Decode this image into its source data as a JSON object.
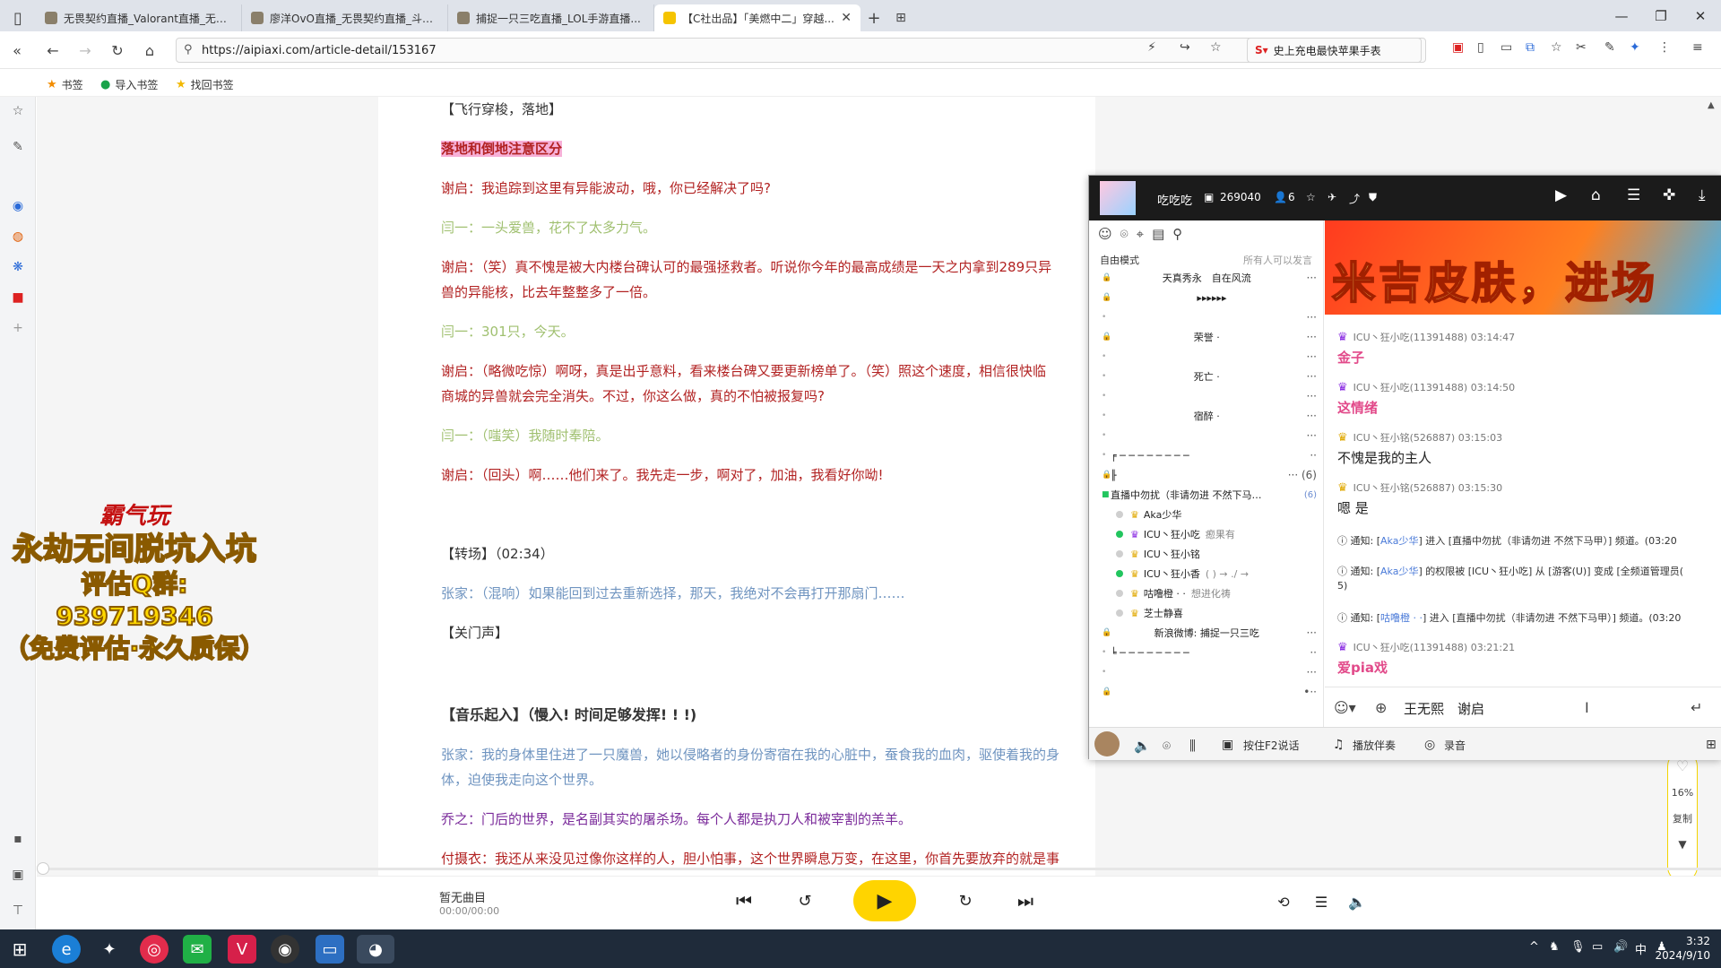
{
  "browser": {
    "tabs": [
      {
        "title": "无畏契约直播_Valorant直播_无畏..."
      },
      {
        "title": "廖洋OvO直播_无畏契约直播_斗鱼..."
      },
      {
        "title": "捕捉一只三吃直播_LOL手游直播..."
      },
      {
        "title": "【C社出品】「美燃中二」穿越..."
      }
    ],
    "url": "https://aipiaxi.com/article-detail/153167",
    "search_text": "史上充电最快苹果手表",
    "bookmarks": [
      "书签",
      "导入书签",
      "找回书签"
    ]
  },
  "article": {
    "lines": [
      {
        "text": "【飞行穿梭，落地】",
        "style": "dk"
      },
      {
        "text": "落地和倒地注意区分",
        "style": "hl"
      },
      {
        "text": "谢启：我追踪到这里有异能波动，哦，你已经解决了吗?",
        "style": "red"
      },
      {
        "text": "闫一：一头爱兽，花不了太多力气。",
        "style": "lg"
      },
      {
        "text": "谢启：（笑）真不愧是被大内楼台碑认可的最强拯救者。听说你今年的最高成绩是一天之内拿到289只异",
        "style": "red"
      },
      {
        "text": "兽的异能核，比去年整整多了一倍。",
        "style": "red"
      },
      {
        "text": "闫一：301只，今天。",
        "style": "lg"
      },
      {
        "text": "谢启：（略微吃惊）啊呀，真是出乎意料，看来楼台碑又要更新榜单了。（笑）照这个速度，相信很快临",
        "style": "red"
      },
      {
        "text": "商城的异兽就会完全消失。不过，你这么做，真的不怕被报复吗?",
        "style": "red"
      },
      {
        "text": "闫一：（嗤笑）我随时奉陪。",
        "style": "lg"
      },
      {
        "text": "谢启：（回头）啊……他们来了。我先走一步，啊对了，加油，我看好你呦!",
        "style": "red"
      },
      {
        "text": "【转场】（02:34）",
        "style": "dk"
      },
      {
        "text": "张家：（混响）如果能回到过去重新选择，那天，我绝对不会再打开那扇门……",
        "style": "bl"
      },
      {
        "text": "【关门声】",
        "style": "dk"
      },
      {
        "text": "【音乐起入】（慢入! 时间足够发挥! ! !)",
        "style": "bold"
      },
      {
        "text": "张家：我的身体里住进了一只魔兽，她以侵略者的身份寄宿在我的心脏中，蚕食我的血肉，驱使着我的身",
        "style": "bl"
      },
      {
        "text": "体，迫使我走向这个世界。",
        "style": "bl"
      },
      {
        "text": "乔之：门后的世界，是名副其实的屠杀场。每个人都是执刀人和被宰割的羔羊。",
        "style": "pu"
      },
      {
        "text": "付摄衣：我还从来没见过像你这样的人，胆小怕事，这个世界瞬息万变，在这里，你首先要放弃的就是事",
        "style": "red"
      }
    ]
  },
  "promo": {
    "line1": "霸气玩",
    "line2": "永劫无间脱坑入坑",
    "line3": "评估Q群: 939719346",
    "line4": "（免费评估·永久质保）"
  },
  "widget": {
    "percent": "16%",
    "copy": "复制"
  },
  "player": {
    "track": "暂无曲目",
    "time": "00:00/00:00",
    "progress": 0
  },
  "taskbar": {
    "time": "3:32",
    "date": "2024/9/10",
    "ime": "中"
  },
  "yy": {
    "header": {
      "name": "吃吃吃",
      "id": "269040",
      "count": "6"
    },
    "mode": "自由模式",
    "mode_hint": "所有人可以发言",
    "channels": [
      {
        "name": "天真秀永　自在风流",
        "dots": "···"
      },
      {
        "name": "▸▸▸▸▸▸",
        "dots": ""
      },
      {
        "name": "",
        "dots": "···"
      },
      {
        "name": "荣誉 ·",
        "dots": "···"
      },
      {
        "name": "",
        "dots": "···"
      },
      {
        "name": "死亡 ·",
        "dots": "···"
      },
      {
        "name": "",
        "dots": "···"
      },
      {
        "name": "宿醉 ·",
        "dots": "···"
      },
      {
        "name": "",
        "dots": "···"
      },
      {
        "name": "╒ ─ ─ ─ ─ ─ ─ ─ ─",
        "dots": "··"
      },
      {
        "name": "╟",
        "dots": "··· (6)"
      }
    ],
    "live_channel": {
      "name": "直播中勿扰（非请勿进 不然下马…",
      "count": "(6)"
    },
    "users": [
      {
        "name": "Aka少华",
        "extra": "",
        "dot": "#cfcfcf"
      },
      {
        "name": "ICU丶狂小吃",
        "extra": "瘛果有",
        "dot": "#22c55e"
      },
      {
        "name": "ICU丶狂小铭",
        "extra": "",
        "dot": "#cfcfcf"
      },
      {
        "name": "ICU丶狂小香",
        "extra": "( ) → ./ →",
        "dot": "#22c55e"
      },
      {
        "name": "咕噜橙 · ·",
        "extra": "想进化祷",
        "dot": "#cfcfcf"
      },
      {
        "name": "芝士静喜",
        "extra": "",
        "dot": "#cfcfcf"
      }
    ],
    "after_channels": [
      {
        "name": "新浪微博: 捕捉一只三吃",
        "dots": "···"
      },
      {
        "name": "╘ ─ ─ ─ ─ ─ ─ ─ ─",
        "dots": "··"
      },
      {
        "name": "",
        "dots": "···"
      },
      {
        "name": "",
        "dots": "•··"
      }
    ],
    "banner": "米吉皮肤，进场",
    "messages": [
      {
        "who": "ICU丶狂小吃(11391488)",
        "time": "03:14:47",
        "text": "金子",
        "color": "pk"
      },
      {
        "who": "ICU丶狂小吃(11391488)",
        "time": "03:14:50",
        "text": "这情绪",
        "color": "pk"
      },
      {
        "who": "ICU丶狂小铭(526887)",
        "time": "03:15:03",
        "text": "不愧是我的主人",
        "color": "bk"
      },
      {
        "who": "ICU丶狂小铭(526887)",
        "time": "03:15:30",
        "text": "嗯 是",
        "color": "bk"
      }
    ],
    "notices": [
      {
        "a": "通知: [",
        "b": "Aka少华",
        "c": "] 进入 [直播中勿扰（非请勿进 不然下马甲）] 频道。(03:20"
      },
      {
        "a": "通知: [",
        "b": "Aka少华",
        "c": "] 的权限被 [ICU丶狂小吃] 从 [游客(U)] 变成 [全频道管理员("
      },
      {
        "a": "通知: [",
        "b": "咕噜橙 · ·",
        "c": "] 进入 [直播中勿扰（非请勿进 不然下马甲）] 频道。(03:20"
      }
    ],
    "notice_tail": "5)",
    "last_msg": {
      "who": "ICU丶狂小吃(11391488)",
      "time": "03:21:21",
      "text": "爱pia戏"
    },
    "input_text": "王无熙　谢启",
    "footer": {
      "f2": "按住F2说话",
      "accompany": "播放伴奏",
      "record": "录音"
    }
  }
}
